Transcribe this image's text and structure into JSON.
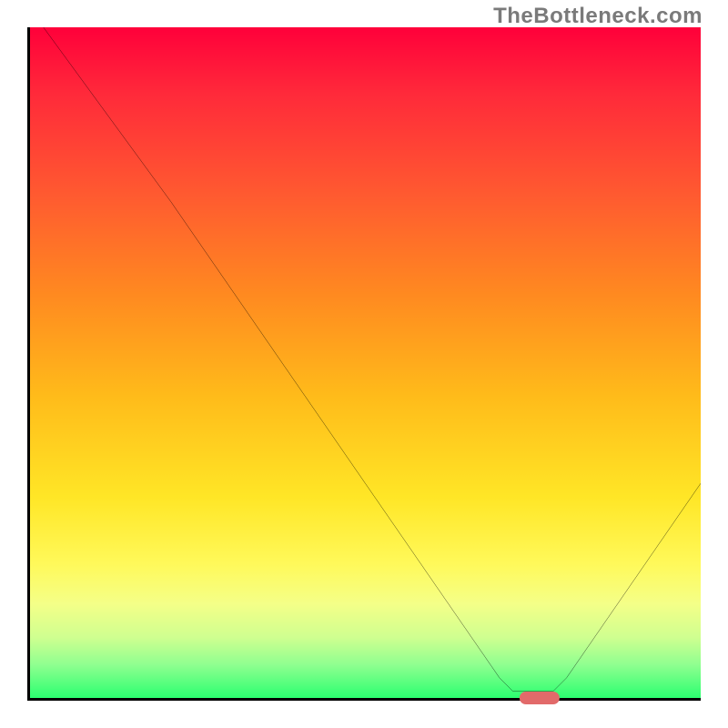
{
  "watermark": "TheBottleneck.com",
  "chart_data": {
    "type": "line",
    "title": "",
    "xlabel": "",
    "ylabel": "",
    "xlim": [
      0,
      100
    ],
    "ylim": [
      0,
      100
    ],
    "grid": false,
    "curve_points": [
      {
        "x": 2,
        "y": 100
      },
      {
        "x": 21,
        "y": 74
      },
      {
        "x": 70,
        "y": 3
      },
      {
        "x": 72,
        "y": 1
      },
      {
        "x": 78,
        "y": 1
      },
      {
        "x": 80,
        "y": 3
      },
      {
        "x": 100,
        "y": 32
      }
    ],
    "optimal_marker": {
      "x": 76,
      "width_pct": 6
    }
  }
}
